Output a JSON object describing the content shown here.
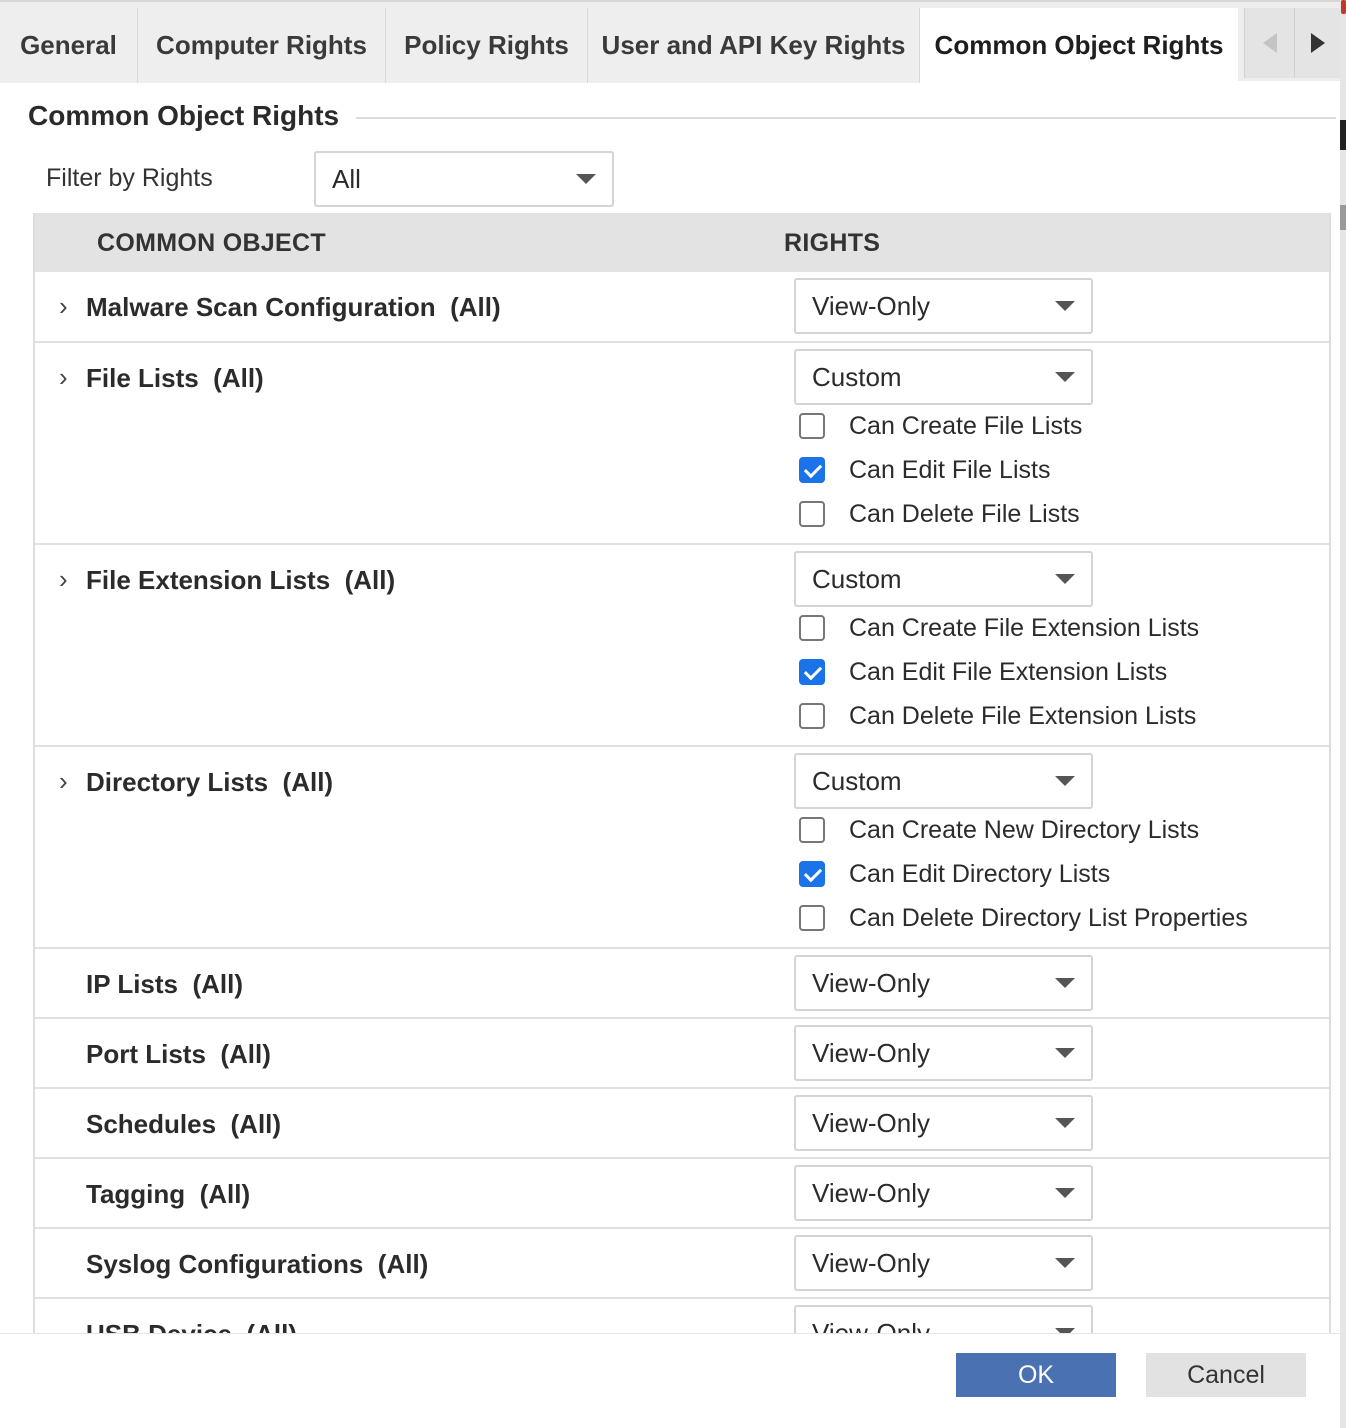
{
  "tabs": {
    "general": "General",
    "computer_rights": "Computer Rights",
    "policy_rights": "Policy Rights",
    "user_api_key_rights": "User and API Key Rights",
    "common_object_rights": "Common Object Rights"
  },
  "section": {
    "title": "Common Object Rights",
    "filter_label": "Filter by Rights",
    "filter_value": "All"
  },
  "table": {
    "col_object": "COMMON OBJECT",
    "col_rights": "RIGHTS"
  },
  "rows": [
    {
      "name": "Malware Scan Configuration",
      "scope": "(All)",
      "rights": "View-Only"
    },
    {
      "name": "File Lists",
      "scope": "(All)",
      "rights": "Custom",
      "options": [
        {
          "label": "Can Create File Lists",
          "checked": false
        },
        {
          "label": "Can Edit File Lists",
          "checked": true
        },
        {
          "label": "Can Delete File Lists",
          "checked": false
        }
      ]
    },
    {
      "name": "File Extension Lists",
      "scope": "(All)",
      "rights": "Custom",
      "options": [
        {
          "label": "Can Create File Extension Lists",
          "checked": false
        },
        {
          "label": "Can Edit File Extension Lists",
          "checked": true
        },
        {
          "label": "Can Delete File Extension Lists",
          "checked": false
        }
      ]
    },
    {
      "name": "Directory Lists",
      "scope": "(All)",
      "rights": "Custom",
      "options": [
        {
          "label": "Can Create New Directory Lists",
          "checked": false
        },
        {
          "label": "Can Edit Directory Lists",
          "checked": true
        },
        {
          "label": "Can Delete Directory List Properties",
          "checked": false
        }
      ]
    },
    {
      "name": "IP Lists",
      "scope": "(All)",
      "rights": "View-Only"
    },
    {
      "name": "Port Lists",
      "scope": "(All)",
      "rights": "View-Only"
    },
    {
      "name": "Schedules",
      "scope": "(All)",
      "rights": "View-Only"
    },
    {
      "name": "Tagging",
      "scope": "(All)",
      "rights": "View-Only"
    },
    {
      "name": "Syslog Configurations",
      "scope": "(All)",
      "rights": "View-Only"
    },
    {
      "name": "USB Device",
      "scope": "(All)",
      "rights": "View-Only"
    }
  ],
  "footer": {
    "ok": "OK",
    "cancel": "Cancel"
  },
  "colors": {
    "ok_button": "#4a72b2",
    "checkbox_checked": "#1a73e8"
  }
}
